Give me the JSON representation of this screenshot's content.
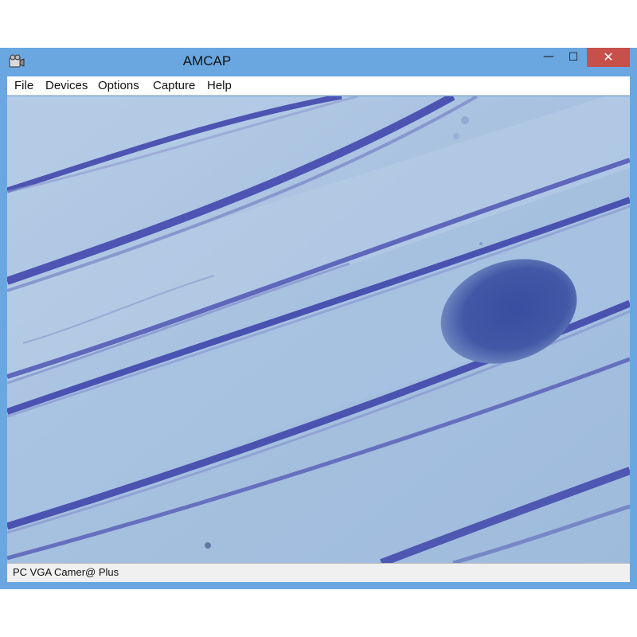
{
  "window": {
    "title": "AMCAP",
    "icon": "camera-icon",
    "controls": {
      "minimize": "—",
      "maximize": "☐",
      "close": "✕"
    }
  },
  "menu": {
    "items": [
      {
        "label": "File"
      },
      {
        "label": "Devices"
      },
      {
        "label": "Options"
      },
      {
        "label": "Capture"
      },
      {
        "label": "Help"
      }
    ]
  },
  "preview": {
    "description_icon": "live-camera-preview"
  },
  "status": {
    "text": "PC VGA Camer@ Plus"
  },
  "colors": {
    "frame": "#6aa7e0",
    "close": "#c7504b",
    "specimen_bg": "#a9c3e1",
    "cell_wall": "#3b3fa8",
    "nucleus": "#3e52a0"
  }
}
